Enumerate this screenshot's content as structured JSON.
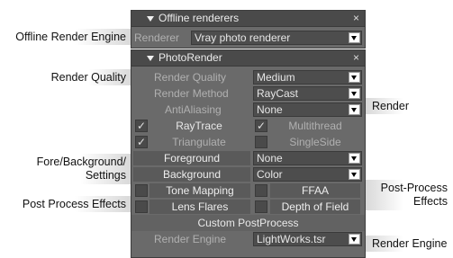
{
  "callouts": {
    "offline_engine": "Offline Render Engine",
    "render_quality": "Render Quality",
    "render": "Render",
    "fore_bg_line1": "Fore/Background/",
    "fore_bg_line2": "Settings",
    "post_process_left": "Post Process Effects",
    "post_process_right_line1": "Post-Process",
    "post_process_right_line2": "Effects",
    "render_engine": "Render Engine"
  },
  "offline_panel": {
    "title": "Offline renderers",
    "close": "×",
    "renderer_label": "Renderer",
    "renderer_value": "Vray photo renderer"
  },
  "photo_panel": {
    "title": "PhotoRender",
    "close": "×",
    "render_quality_label": "Render Quality",
    "render_quality_value": "Medium",
    "render_method_label": "Render Method",
    "render_method_value": "RayCast",
    "antialiasing_label": "AntiAliasing",
    "antialiasing_value": "None",
    "raytrace_label": "RayTrace",
    "raytrace_checked": true,
    "multithread_label": "Multithread",
    "multithread_checked": true,
    "triangulate_label": "Triangulate",
    "triangulate_checked": true,
    "singleside_label": "SingleSide",
    "singleside_checked": false,
    "foreground_label": "Foreground",
    "foreground_value": "None",
    "background_label": "Background",
    "background_value": "Color",
    "tone_mapping_label": "Tone Mapping",
    "ffaa_label": "FFAA",
    "lens_flares_label": "Lens Flares",
    "depth_of_field_label": "Depth of Field",
    "custom_postprocess_label": "Custom PostProcess",
    "render_engine_label": "Render Engine",
    "render_engine_value": "LightWorks.tsr",
    "check_glyph": "✓"
  }
}
